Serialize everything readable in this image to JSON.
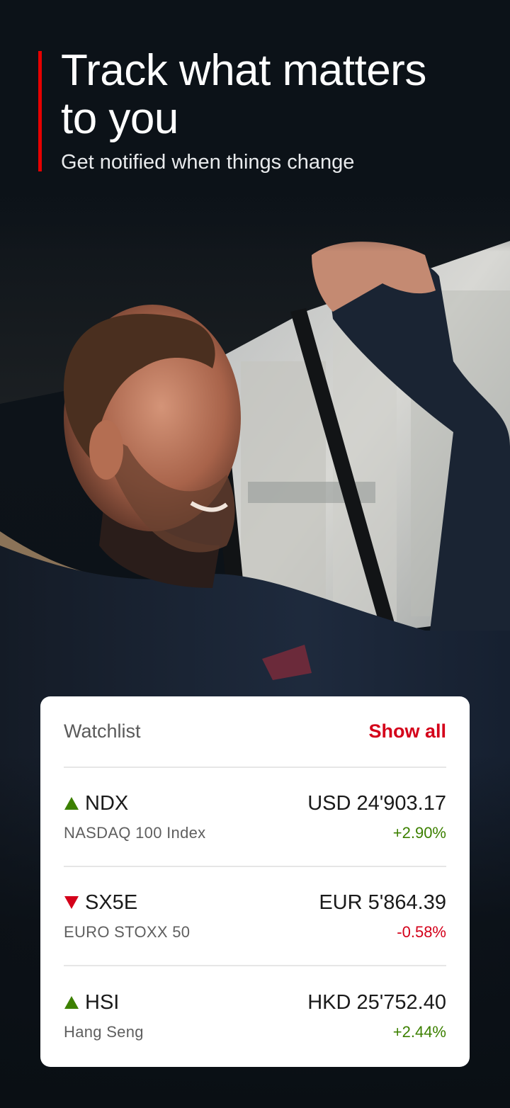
{
  "header": {
    "title": "Track what matters to you",
    "subtitle": "Get notified when things change",
    "accent_color": "#e60000"
  },
  "background_image": {
    "description_icon": "photo-man-in-car"
  },
  "watchlist": {
    "title": "Watchlist",
    "show_all_label": "Show all",
    "items": [
      {
        "ticker": "NDX",
        "name": "NASDAQ 100 Index",
        "price": "USD 24'903.17",
        "change": "+2.90%",
        "direction": "up",
        "direction_icon": "triangle-up-icon"
      },
      {
        "ticker": "SX5E",
        "name": "EURO STOXX 50",
        "price": "EUR 5'864.39",
        "change": "-0.58%",
        "direction": "down",
        "direction_icon": "triangle-down-icon"
      },
      {
        "ticker": "HSI",
        "name": "Hang Seng",
        "price": "HKD 25'752.40",
        "change": "+2.44%",
        "direction": "up",
        "direction_icon": "triangle-up-icon"
      }
    ]
  },
  "colors": {
    "positive": "#3c8000",
    "negative": "#d4001a",
    "brand_red": "#e60000"
  }
}
